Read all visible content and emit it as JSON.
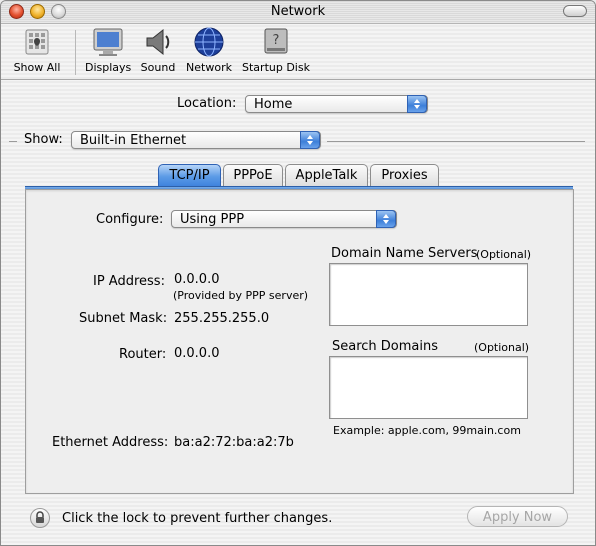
{
  "window": {
    "title": "Network"
  },
  "toolbar": {
    "items": [
      {
        "label": "Show All",
        "icon": "show-all-icon"
      },
      {
        "label": "Displays",
        "icon": "displays-icon"
      },
      {
        "label": "Sound",
        "icon": "sound-icon"
      },
      {
        "label": "Network",
        "icon": "network-globe-icon"
      },
      {
        "label": "Startup Disk",
        "icon": "startup-disk-icon"
      }
    ]
  },
  "location": {
    "label": "Location:",
    "value": "Home"
  },
  "show": {
    "label": "Show:",
    "value": "Built-in Ethernet"
  },
  "tabs": [
    {
      "label": "TCP/IP",
      "active": true
    },
    {
      "label": "PPPoE",
      "active": false
    },
    {
      "label": "AppleTalk",
      "active": false
    },
    {
      "label": "Proxies",
      "active": false
    }
  ],
  "tcpip": {
    "configure_label": "Configure:",
    "configure_value": "Using PPP",
    "ip_label": "IP Address:",
    "ip_value": "0.0.0.0",
    "ip_note": "(Provided by PPP server)",
    "subnet_label": "Subnet Mask:",
    "subnet_value": "255.255.255.0",
    "router_label": "Router:",
    "router_value": "0.0.0.0",
    "dns_label": "Domain Name Servers",
    "dns_optional": "(Optional)",
    "search_label": "Search Domains",
    "search_optional": "(Optional)",
    "example": "Example: apple.com, 99main.com",
    "ethernet_label": "Ethernet Address:",
    "ethernet_value": "ba:a2:72:ba:a2:7b"
  },
  "footer": {
    "lock_text": "Click the lock to prevent further changes.",
    "apply_label": "Apply Now"
  },
  "colors": {
    "accent": "#3f83de",
    "disabled_text": "#a6a6a6"
  }
}
